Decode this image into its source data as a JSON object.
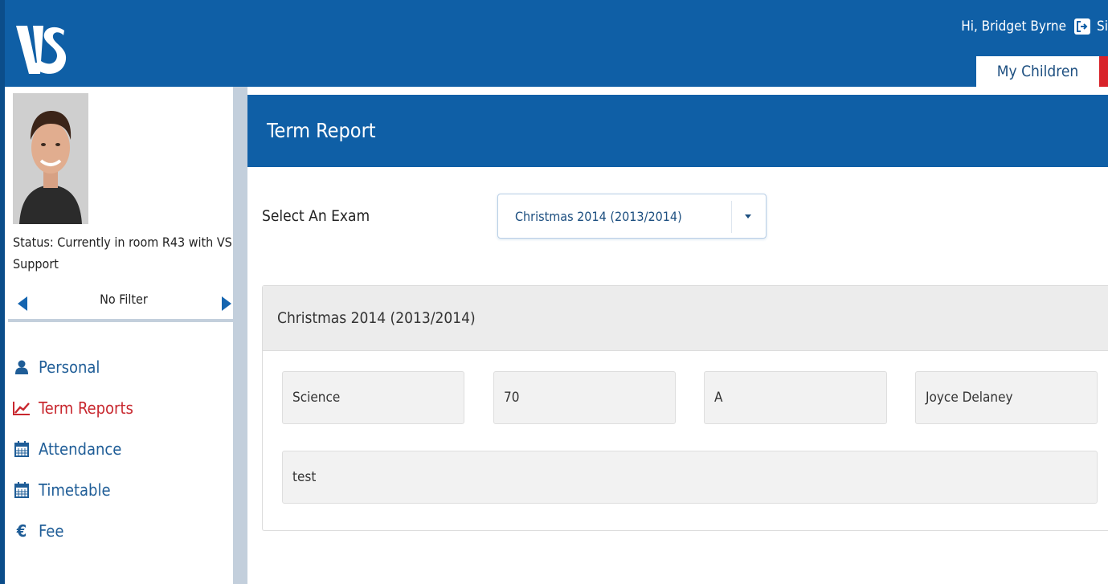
{
  "header": {
    "logo_text": "VS",
    "greeting": "Hi, Bridget Byrne",
    "signout_label": "Sign out",
    "tabs": [
      {
        "label": "My Children",
        "active": true
      }
    ],
    "brand_color": "#0f5fa6",
    "accent_color": "#d8232a"
  },
  "sidebar": {
    "status": "Status: Currently in room R43 with VS Support",
    "filter_label": "No Filter",
    "items": [
      {
        "label": "Personal",
        "icon": "user-icon",
        "active": false
      },
      {
        "label": "Term Reports",
        "icon": "line-chart-icon",
        "active": true
      },
      {
        "label": "Attendance",
        "icon": "calendar-icon",
        "active": false
      },
      {
        "label": "Timetable",
        "icon": "calendar-icon",
        "active": false
      },
      {
        "label": "Fee",
        "icon": "euro-icon",
        "active": false
      }
    ]
  },
  "main": {
    "title": "Term Report",
    "exam_label": "Select An Exam",
    "exam_select": {
      "value": "Christmas 2014 (2013/2014)"
    },
    "panel": {
      "title": "Christmas 2014 (2013/2014)",
      "result": {
        "subject": "Science",
        "score": "70",
        "grade": "A",
        "teacher": "Joyce Delaney",
        "comment": "test"
      }
    }
  }
}
